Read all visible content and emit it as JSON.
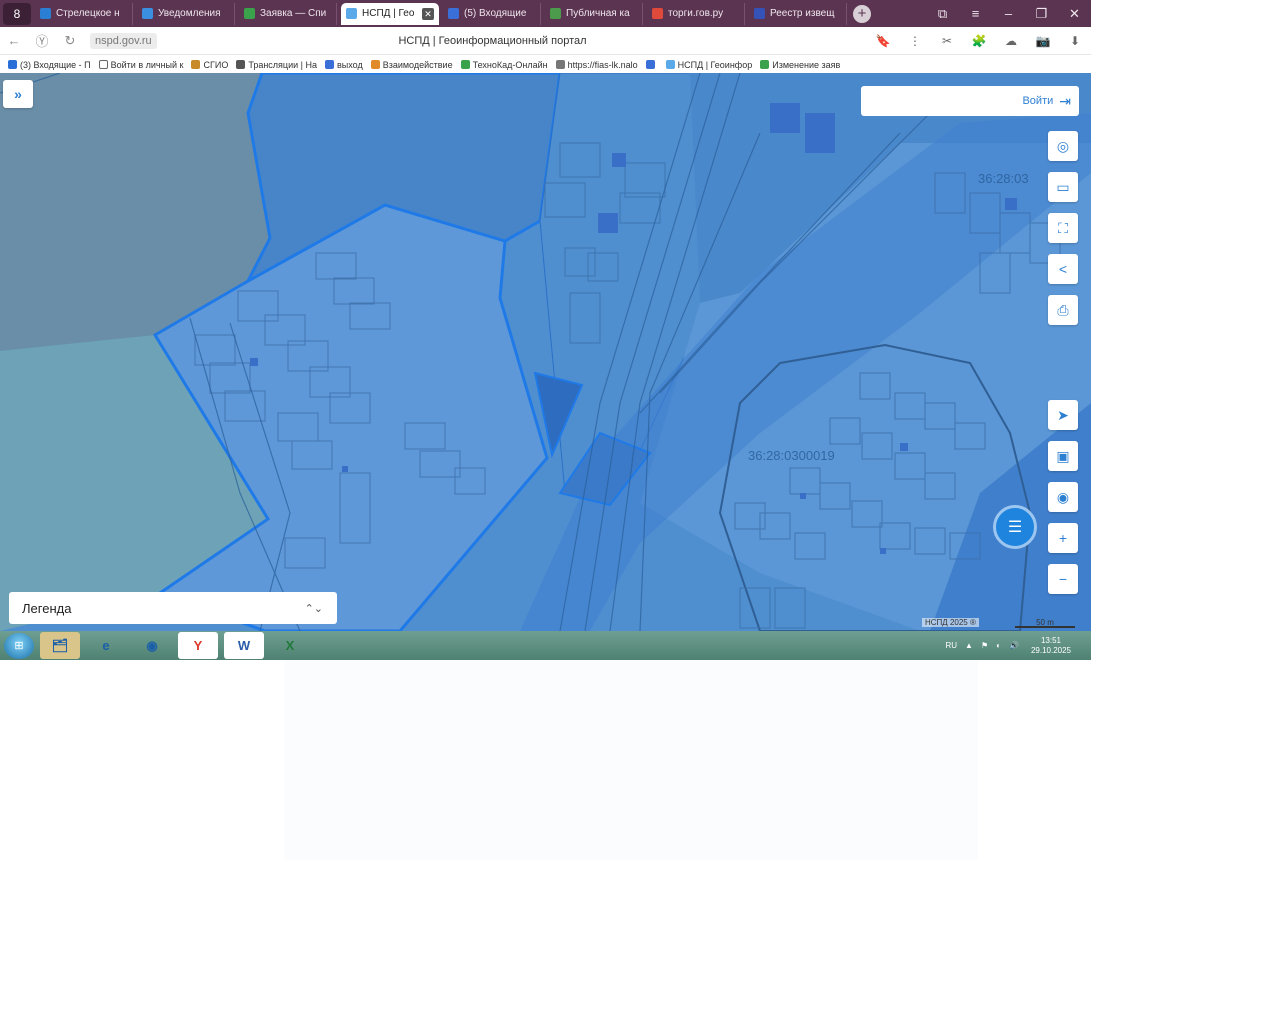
{
  "browser": {
    "menu_glyph": "8",
    "tabs": [
      {
        "label": "Стрелецкое н",
        "color": "#2a7fd4",
        "active": false
      },
      {
        "label": "Уведомления",
        "color": "#3a8fe0",
        "active": false
      },
      {
        "label": "Заявка — Спи",
        "color": "#3aa24a",
        "active": false
      },
      {
        "label": "НСПД | Гео",
        "color": "#5aa9e8",
        "active": true
      },
      {
        "label": "(5) Входящие",
        "color": "#3a6fd8",
        "active": false
      },
      {
        "label": "Публичная ка",
        "color": "#4c9a4c",
        "active": false
      },
      {
        "label": "торги.гов.ру",
        "color": "#e04a3a",
        "active": false
      },
      {
        "label": "Реестр извещ",
        "color": "#3552b8",
        "active": false
      }
    ],
    "tab_close_glyph": "✕",
    "new_tab_glyph": "+",
    "window_controls": [
      "⧉",
      "≡",
      "–",
      "❐",
      "✕"
    ],
    "url": "nspd.gov.ru",
    "page_title": "НСПД | Геоинформационный портал",
    "nav": {
      "back": "←",
      "yandex": "Ⓨ",
      "reload": "↻",
      "lock": "🔒"
    },
    "toolbar_icons": [
      "🔖",
      "⋮",
      "✂",
      "🧩",
      "☁",
      "📷",
      "⬇"
    ],
    "bookmarks": [
      {
        "label": "(3) Входящие - П",
        "color": "#2a6fd8"
      },
      {
        "label": "Войти в личный к",
        "color": "#ffffff"
      },
      {
        "label": "СГИО",
        "color": "#c98a2a"
      },
      {
        "label": "Трансляции | На",
        "color": "#555555"
      },
      {
        "label": "выход",
        "color": "#3a6fd8"
      },
      {
        "label": "Взаимодействие",
        "color": "#e08a2a"
      },
      {
        "label": "ТехноКад-Онлайн",
        "color": "#3aa24a"
      },
      {
        "label": "https://fias-lk.nalo",
        "color": "#777777"
      },
      {
        "label": "",
        "color": "#3a6fd8"
      },
      {
        "label": "НСПД | Геоинфор",
        "color": "#5aa9e8"
      },
      {
        "label": "Изменение заяв",
        "color": "#3aa24a"
      }
    ]
  },
  "map": {
    "expand_glyph": "»",
    "login_label": "Войти",
    "login_glyph": "⇥",
    "tools": [
      {
        "name": "layers-button",
        "glyph": "◎"
      },
      {
        "name": "measure-button",
        "glyph": "▭"
      },
      {
        "name": "select-area-button",
        "glyph": "⛶"
      },
      {
        "name": "share-button",
        "glyph": "<"
      },
      {
        "name": "print-button",
        "glyph": "⎙"
      },
      {
        "name": "locate-button",
        "glyph": "➤"
      },
      {
        "name": "basemap-button",
        "glyph": "▣"
      },
      {
        "name": "pin-button",
        "glyph": "◉"
      },
      {
        "name": "zoom-in-button",
        "glyph": "+"
      },
      {
        "name": "zoom-out-button",
        "glyph": "−"
      }
    ],
    "cadastral_labels": [
      "36:28:03",
      "36:28:0300019"
    ],
    "legend_label": "Легенда",
    "legend_chevron": "⌃⌄",
    "chat_glyph": "☰",
    "copyright": "НСПД 2025 ®",
    "scale_label": "50 m",
    "colors": {
      "water": "#4f8fd0",
      "outline": "#1f7ae8",
      "grey_area": "#6a8ea8",
      "teal_area": "#6ea3b7"
    }
  },
  "taskbar": {
    "start_glyph": "⊞",
    "apps": [
      {
        "name": "explorer",
        "glyph": "🗂",
        "bg": "#d9c58a"
      },
      {
        "name": "ie",
        "glyph": "e",
        "bg": "transparent"
      },
      {
        "name": "chrome",
        "glyph": "◉",
        "bg": "transparent"
      },
      {
        "name": "yandex",
        "glyph": "Y",
        "bg": "#ffffff"
      },
      {
        "name": "word",
        "glyph": "W",
        "bg": "#ffffff"
      },
      {
        "name": "excel",
        "glyph": "X",
        "bg": "transparent"
      }
    ],
    "lang": "RU",
    "tray_icons": [
      "▲",
      "⚑",
      "◐",
      "🔊"
    ],
    "time": "13:51",
    "date": "29.10.2025"
  }
}
